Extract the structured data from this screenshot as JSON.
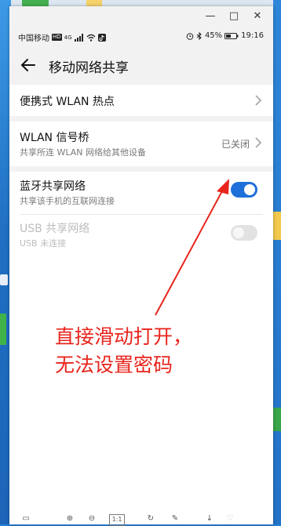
{
  "window": {
    "controls": {
      "minimize": "—",
      "maximize": "□",
      "close": "✕"
    }
  },
  "statusbar": {
    "carrier": "中国移动",
    "carrier_badge": "HD",
    "network": "4G",
    "battery": "45%",
    "time": "19:16"
  },
  "appbar": {
    "title": "移动网络共享"
  },
  "settings": {
    "hotspot": {
      "title": "便携式 WLAN 热点"
    },
    "bridge": {
      "title": "WLAN 信号桥",
      "subtitle": "共享所连 WLAN 网络给其他设备",
      "status": "已关闭"
    },
    "bluetooth": {
      "title": "蓝牙共享网络",
      "subtitle": "共享该手机的互联网连接",
      "enabled": true
    },
    "usb": {
      "title": "USB 共享网络",
      "subtitle": "USB 未连接",
      "enabled": false
    }
  },
  "annotation": {
    "line1": "直接滑动打开，",
    "line2": "无法设置密码",
    "color": "#e8241c"
  },
  "bottom_toolbar": {
    "ratio_label": "1:1"
  },
  "colors": {
    "accent": "#1e6fd9",
    "background": "#f2f2f2"
  }
}
